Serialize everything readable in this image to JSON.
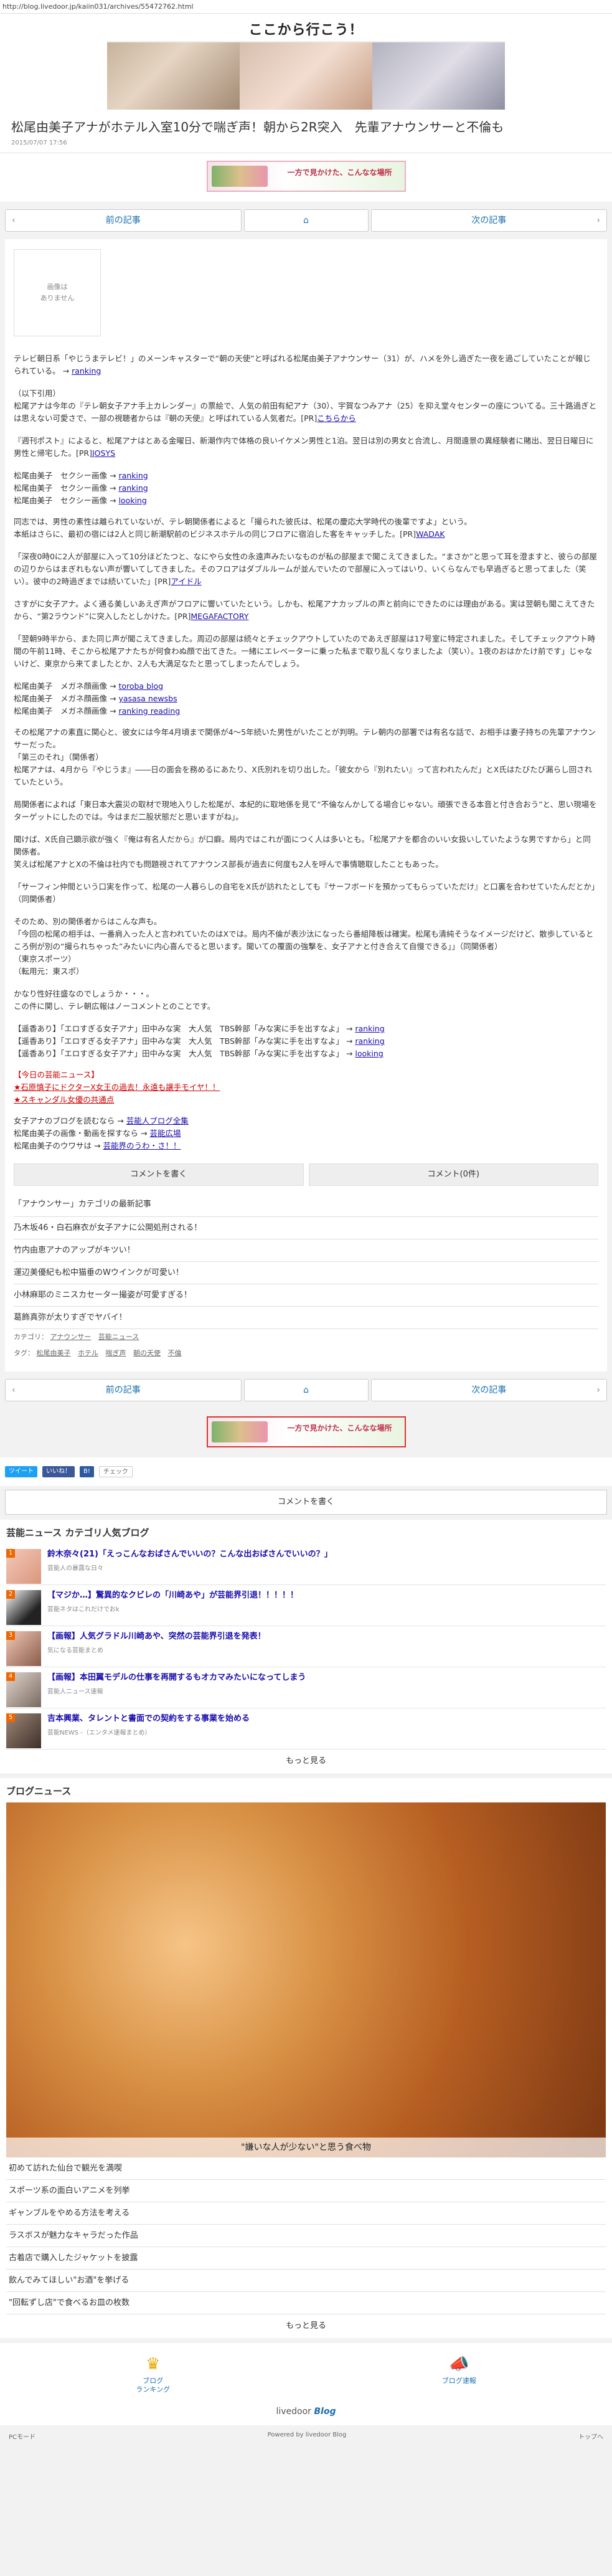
{
  "url": "http://blog.livedoor.jp/kaiin031/archives/55472762.html",
  "blog_title": "ここから行こう！",
  "article": {
    "title": "松尾由美子アナがホテル入室10分で喘ぎ声！朝から2R突入　先輩アナウンサーと不倫も",
    "date": "2015/07/07 17:56"
  },
  "banner_text": "一方で見かけた、こんなな場所",
  "pager": {
    "prev": "前の記事",
    "next": "次の記事",
    "home_icon": "home-icon"
  },
  "noimage": "画像は\nありません",
  "body": {
    "p1": "テレビ朝日系「やじうまテレビ！」のメーンキャスターで“朝の天使”と呼ばれる松尾由美子アナウンサー（31）が、ハメを外し過ぎた一夜を過ごしていたことが報じられている。",
    "p1_link": "ranking",
    "p2": "（以下引用）\n松尾アナは今年の『テレ朝女子アナ手上カレンダー』の票絵で、人気の前田有紀アナ（30）、宇賀なつみアナ（25）を抑え堂々センターの座についてる。三十路過ぎとは思えない可愛さで、一部の視聴者からは『朝の天使』と呼ばれている人気者だ。[PR]",
    "p2_link": "こちらから",
    "p3": "『週刊ポスト』によると、松尾アナはとある金曜日、新潮作内で体格の良いイケメン男性と1泊。翌日は別の男女と合流し、月間遠景の異経験者に賭出、翌日日曜日に男性と帰宅した。[PR]",
    "p3_link": "JOSYS",
    "list1": [
      "松尾由美子　セクシー画像 →",
      "松尾由美子　セクシー画像 →",
      "松尾由美子　セクシー画像 →"
    ],
    "list1_links": [
      "ranking",
      "ranking",
      "looking"
    ],
    "p4": "同志では、男性の素性は離られていないが、テレ朝関係者によると「撮られた彼氏は、松尾の慶応大学時代の後輩ですよ」という。\n本紙はさらに、最初の宿には2人と同じ新潮駅前のビジネスホテルの同じフロアに宿泊した客をキャッチした。[PR]",
    "p4_link": "WADAK",
    "p5": "「深夜0時0に2人が部屋に入って10分ほどたつと、なにやら女性の永遠声みたいなものが私の部屋まで聞こえてきました。“まさか”と思って耳を澄ますと、彼らの部屋の辺りからはまぎれもない声が響いてしてきました。そのフロアはダブルルームが並んでいたので部屋に入ってはいり、いくらなんでも早過ぎると思ってました（笑い）。彼中の2時過ぎまでは続いていた」[PR]",
    "p5_link": "アイドル",
    "p6": "さすがに女子アナ。よく通る美しいあえぎ声がフロアに響いていたという。しかも、松尾アナカップルの声と前向にできたのには理由がある。実は翌朝も聞こえてきたから、“第2ラウンド”に突入したとしかけた。[PR]",
    "p6_link": "MEGAFACTORY",
    "p7": "「翌朝9時半から、また同じ声が聞こえてきました。周辺の部屋は続々とチェックアウトしていたのであえぎ部屋は17号室に特定されました。そしてチェックアウト時間の午前11時、そこから松尾アナたちが何食わぬ顔で出てきた。一緒にエレベーターに乗った私まで取り乱くなりましたよ（笑い）。1夜のおはかたけ前です」じゃないけど、東京から来てましたとか、2人も大満足なたと思ってしまったんでしょう。",
    "list2": [
      "松尾由美子　メガネ顔画像 →",
      "松尾由美子　メガネ顔画像 →",
      "松尾由美子　メガネ顔画像 →"
    ],
    "list2_links": [
      "toroba blog",
      "yasasa newsbs",
      "ranking reading"
    ],
    "p8": "その松尾アナの素直に関心と、彼女には今年4月頃まで関係が4～5年続いた男性がいたことが判明。テレ朝内の部署では有名な話で、お相手は妻子持ちの先輩アナウンサーだった。\n「第三のそれ」（関係者）\n松尾アナは、4月から『やじうま』――日の面会を務めるにあたり、X氏別れを切り出した。「彼女から『別れたい』って言われたんだ」とX氏はたびたび漏らし回されていたという。",
    "p9": "局関係者によれば「東日本大震災の取材で現地入りした松尾が、本紀的に取地係を見て“不倫なんかしてる場合じゃない。頑張できる本音と付き合おう”と、思い現場をターゲットにしたのでは。今はまだ二股状態だと思いますがね」。",
    "p10": "聞けば、X氏自己顕示欲が強く『俺は有名人だから』が口癖。局内ではこれが面につく人は多いとも。「松尾アナを都合のいい女扱いしていたような男ですから」と同関係者。\n笑えば松尾アナとXの不倫は社内でも問題視されてアナウンス部長が過去に何度も2人を呼んで事情聴取したこともあった。",
    "p11": "「サーフィン仲間という口実を作って、松尾の一人暮らしの自宅をX氏が訪れたとしても『サーフボードを預かってもらっていただけ』と口裏を合わせていたんだとか」（同関係者）",
    "p12": "そのため、別の関係者からはこんな声も。\n「今回の松尾の相手は、一番肩入った人と言われていたのはXでは。局内不倫が表沙汰になったら番組降板は確実。松尾も清純そうなイメージだけど、散歩しているところ例が別の“撮られちゃった”みたいに内心喜んでると思います。聞いての覆面の強撃を、女子アナと付き合えて自慢できる」」（同関係者）\n（東京スポーツ）\n（転用元：東スポ）",
    "p13": "かなり性好往盛なのでしょうか・・・。\nこの件に関し、テレ朝広報はノーコメントとのことです。",
    "list3": [
      "【遥香あり】「エロすぎる女子アナ」田中みな実　大人気　TBS幹部「みな実に手を出すなよ」 →",
      "【遥香あり】「エロすぎる女子アナ」田中みな実　大人気　TBS幹部「みな実に手を出すなよ」 →",
      "【遥香あり】「エロすぎる女子アナ」田中みな実　大人気　TBS幹部「みな実に手を出すなよ」 →"
    ],
    "list3_links": [
      "ranking",
      "ranking",
      "looking"
    ],
    "today_title": "【今日の芸能ニュース】",
    "today_items": [
      "★石原慎子にドクターX女王の過去！永遠も譲手モイヤ！！",
      "★スキャンダル女優の共通点"
    ],
    "tail_lines": [
      "女子アナのブログを読むなら →",
      "松尾由美子の画像・動画を探すなら →",
      "松尾由美子のウワサは →"
    ],
    "tail_links": [
      "芸能人ブログ全集",
      "芸能広場",
      "芸能界のうわ・さ！！"
    ]
  },
  "comment_buttons": {
    "write": "コメントを書く",
    "count": "コメント(0件)"
  },
  "related": {
    "title": "「アナウンサー」カテゴリの最新記事",
    "items": [
      "乃木坂46・白石麻衣が女子アナに公開処刑される！",
      "竹内由恵アナのアップがキツい！",
      "運辺美優紀も松中猫垂のWウインクが可愛い！",
      "小林麻耶のミニスカセーター撮姿が可愛すぎる！",
      "葛飾真弥が太りすぎでヤバイ！"
    ]
  },
  "meta": {
    "category_label": "カテゴリ：",
    "category_links": [
      "アナウンサー",
      "芸能ニュース"
    ],
    "tag_label": "タグ：",
    "tag_links": [
      "松尾由美子",
      "ホテル",
      "喘ぎ声",
      "朝の天使",
      "不倫"
    ]
  },
  "sns": {
    "tweet": "ツイート",
    "like": "いいね！",
    "hatena": "B!",
    "check": "チェック"
  },
  "comment_write": "コメントを書く",
  "ranking": {
    "title": "芸能ニュース カテゴリ人気ブログ",
    "items": [
      {
        "rank": "1",
        "title": "鈴木奈々(21)「えっこんなおばさんでいいの？こんな出おばさんでいいの？」",
        "sub": "芸能人の暴露な日々"
      },
      {
        "rank": "2",
        "title": "【マジか…】驚異的なクビレの「川崎あや」が芸能界引退！！！！！",
        "sub": "芸能ネタはこれだけでおk"
      },
      {
        "rank": "3",
        "title": "【画報】人気グラドル川崎あや、突然の芸能界引退を発表！",
        "sub": "気になる芸能まとめ"
      },
      {
        "rank": "4",
        "title": "【画報】本田翼モデルの仕事を再開するもオカマみたいになってしまう",
        "sub": "芸能人ニュース速報"
      },
      {
        "rank": "5",
        "title": "吉本興業、タレントと書面での契約をする事業を始める",
        "sub": "芸能NEWS -（エンタメ速報まとめ）"
      }
    ],
    "more": "もっと見る"
  },
  "blog_news": {
    "title": "ブログニュース",
    "caption": "\"嫌いな人が少ない\"と思う食べ物",
    "items": [
      "初めて訪れた仙台で観光を満喫",
      "スポーツ系の面白いアニメを列挙",
      "ギャンブルをやめる方法を考える",
      "ラスボスが魅力なキャラだった作品",
      "古着店で購入したジャケットを披露",
      "飲んでみてほしい\"お酒\"を挙げる",
      "\"回転ずし店\"で食べるお皿の枚数"
    ],
    "more": "もっと見る"
  },
  "footer": {
    "ranking_label": "ブログ\nランキング",
    "news_label": "ブログ速報",
    "livedoor": "livedoor",
    "blog": "Blog",
    "pc_mode": "PCモード",
    "powered": "Powered by livedoor Blog",
    "top": "トップへ"
  }
}
